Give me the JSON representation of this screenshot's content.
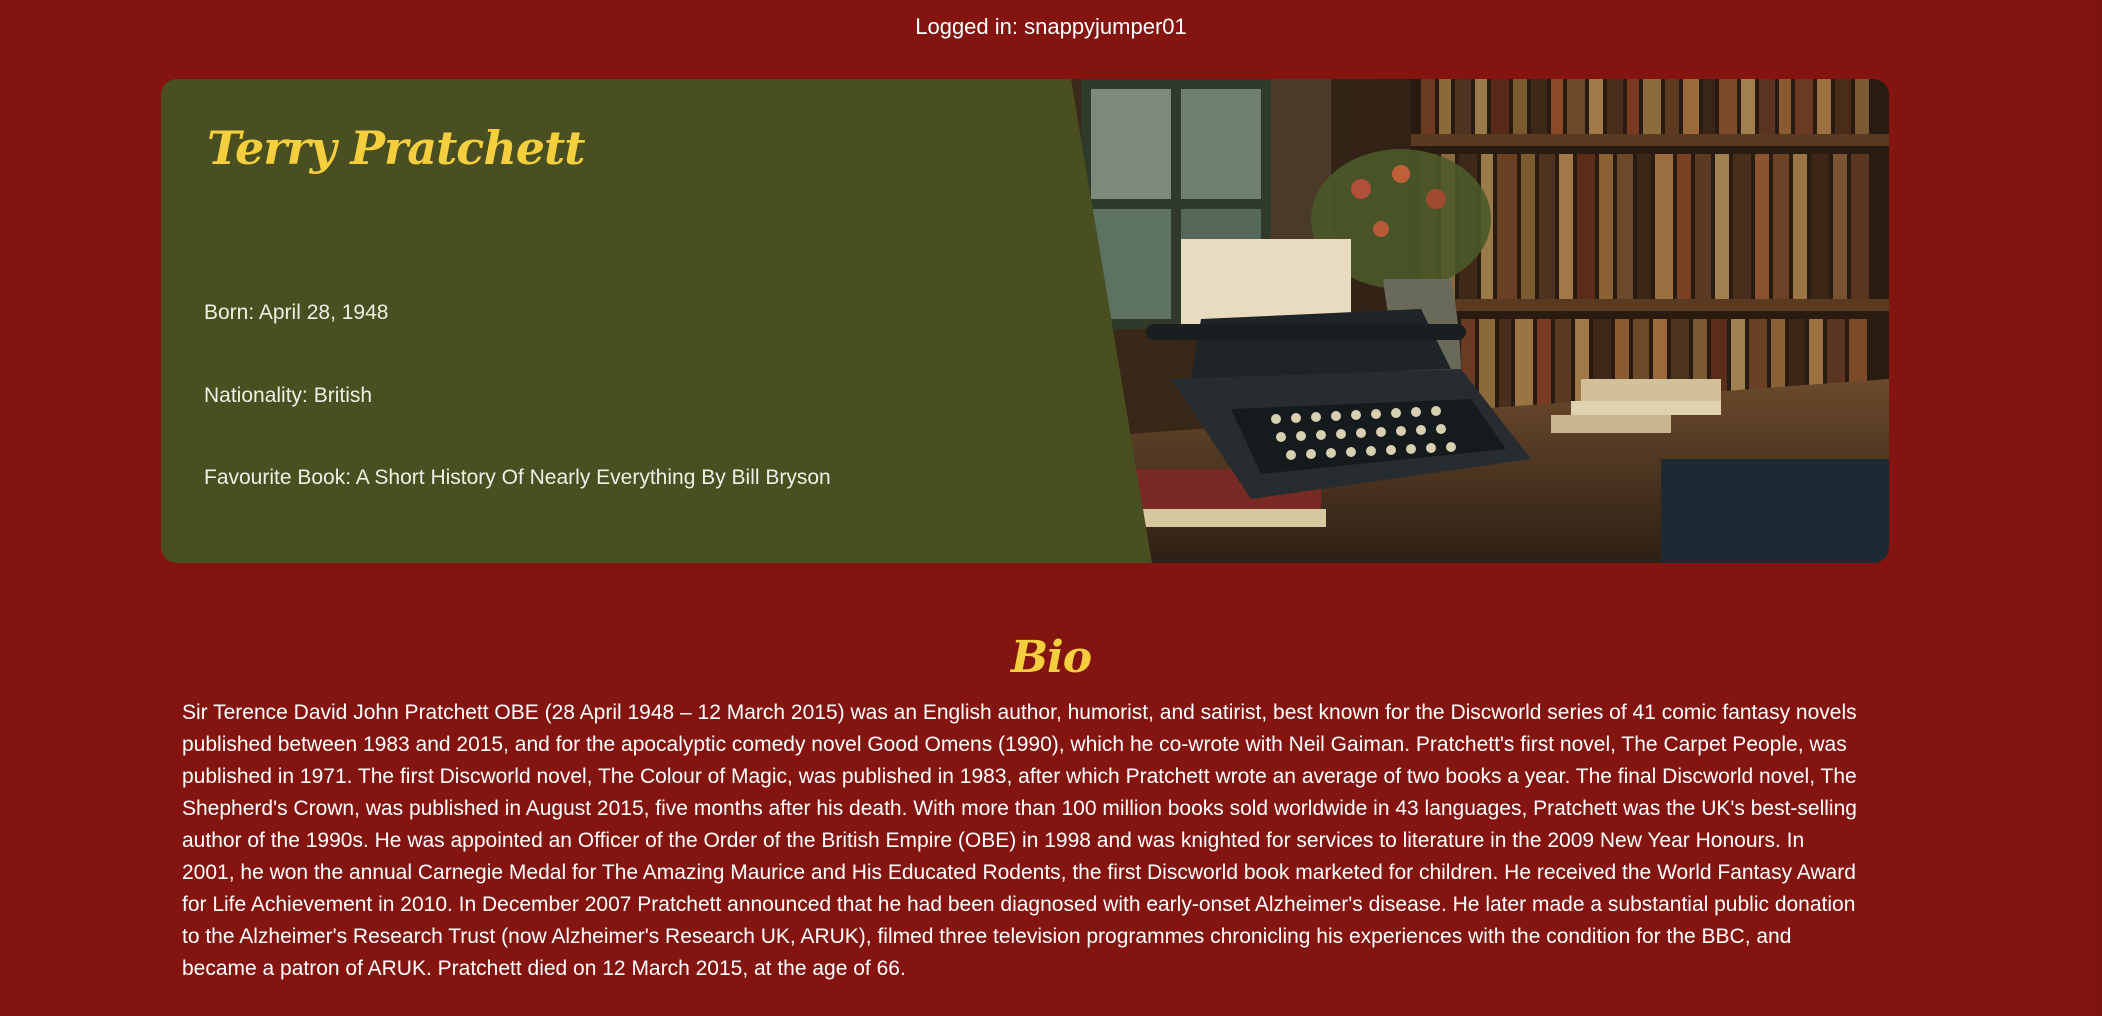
{
  "header": {
    "login_status": "Logged in: snappyjumper01"
  },
  "author": {
    "name": "Terry Pratchett",
    "born": "Born: April 28, 1948",
    "nationality": "Nationality: British",
    "favourite_book": "Favourite Book: A Short History Of Nearly Everything By Bill Bryson"
  },
  "hero_image": {
    "description_icon": "typewriter-bookshelf-image"
  },
  "bio": {
    "heading": "Bio",
    "text": "Sir Terence David John Pratchett OBE (28 April 1948 – 12 March 2015) was an English author, humorist, and satirist, best known for the Discworld series of 41 comic fantasy novels published between 1983 and 2015, and for the apocalyptic comedy novel Good Omens (1990), which he co-wrote with Neil Gaiman. Pratchett's first novel, The Carpet People, was published in 1971. The first Discworld novel, The Colour of Magic, was published in 1983, after which Pratchett wrote an average of two books a year. The final Discworld novel, The Shepherd's Crown, was published in August 2015, five months after his death. With more than 100 million books sold worldwide in 43 languages, Pratchett was the UK's best-selling author of the 1990s. He was appointed an Officer of the Order of the British Empire (OBE) in 1998 and was knighted for services to literature in the 2009 New Year Honours. In 2001, he won the annual Carnegie Medal for The Amazing Maurice and His Educated Rodents, the first Discworld book marketed for children. He received the World Fantasy Award for Life Achievement in 2010. In December 2007 Pratchett announced that he had been diagnosed with early-onset Alzheimer's disease. He later made a substantial public donation to the Alzheimer's Research Trust (now Alzheimer's Research UK, ARUK), filmed three television programmes chronicling his experiences with the condition for the BBC, and became a patron of ARUK. Pratchett died on 12 March 2015, at the age of 66."
  },
  "colors": {
    "page_background": "#84140f",
    "card_background": "#4a4f22",
    "accent_yellow": "#f6cf3e"
  }
}
